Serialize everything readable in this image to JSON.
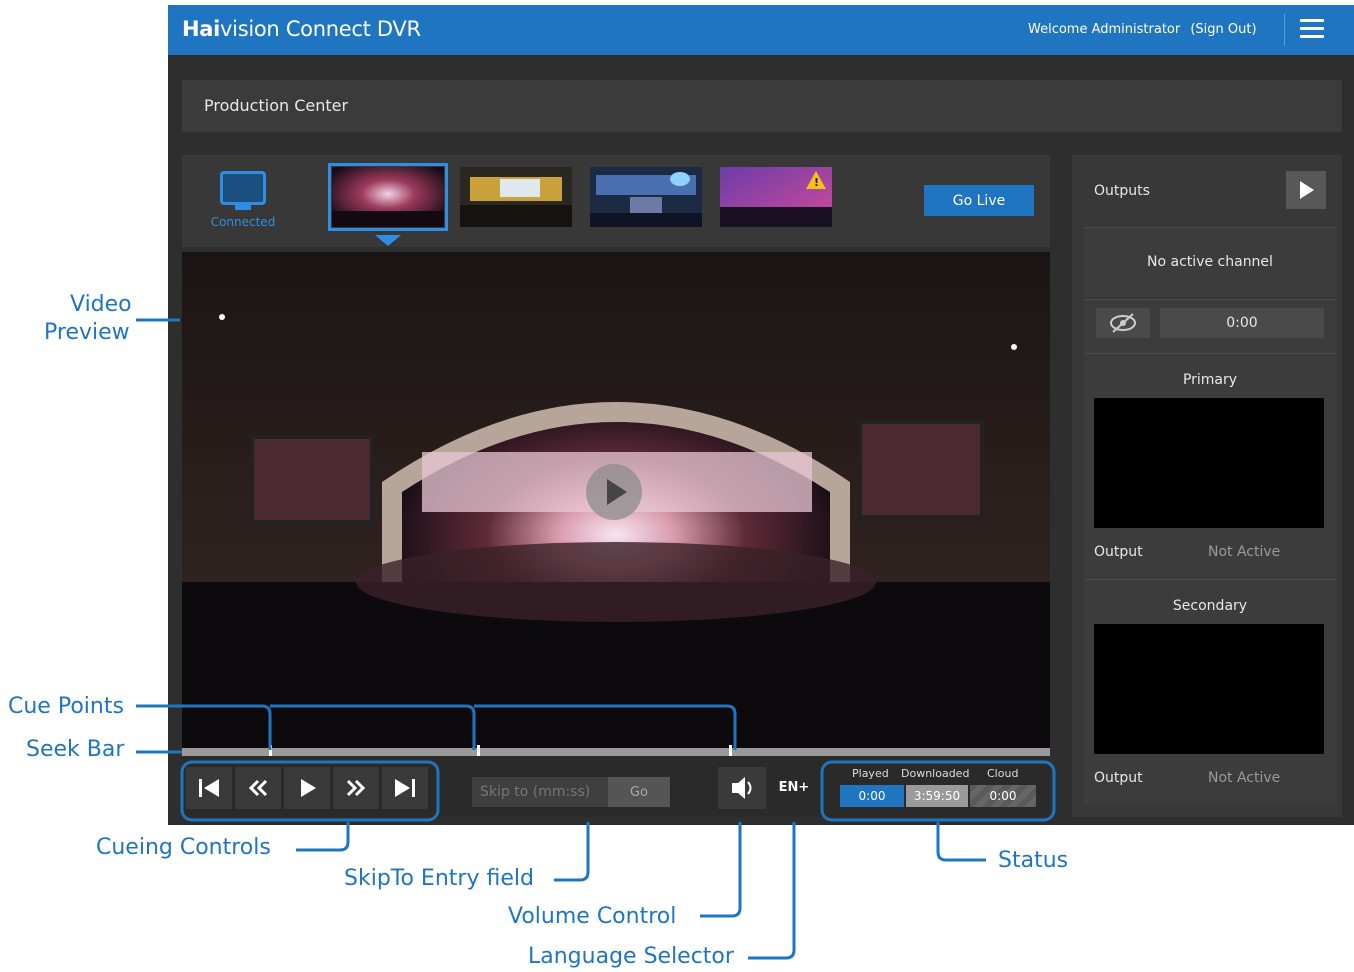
{
  "app": {
    "brand_bold": "Hai",
    "brand_rest": "vision Connect DVR",
    "welcome": "Welcome Administrator",
    "sign_out": "(Sign Out)",
    "page_title": "Production Center"
  },
  "channels": {
    "connected_label": "Connected",
    "go_live": "Go Live"
  },
  "seek": {
    "cue_points_fraction": [
      0.1,
      0.34,
      0.63
    ]
  },
  "controls": {
    "skip_placeholder": "Skip to (mm:ss)",
    "go": "Go",
    "language": "EN+",
    "status": {
      "played_header": "Played",
      "downloaded_header": "Downloaded",
      "cloud_header": "Cloud",
      "played": "0:00",
      "downloaded": "3:59:50",
      "cloud": "0:00"
    }
  },
  "outputs": {
    "header": "Outputs",
    "no_active_channel": "No active channel",
    "time": "0:00",
    "primary_title": "Primary",
    "secondary_title": "Secondary",
    "output_label": "Output",
    "not_active": "Not Active"
  },
  "annotations": {
    "video_preview_1": "Video",
    "video_preview_2": "Preview",
    "cue_points": "Cue Points",
    "seek_bar": "Seek Bar",
    "cueing_controls": "Cueing Controls",
    "skipto": "SkipTo Entry field",
    "volume": "Volume Control",
    "language": "Language Selector",
    "status": "Status"
  },
  "colors": {
    "brand_blue": "#1f75c0",
    "annotation_blue": "#1f75c0",
    "warning_yellow": "#f5c018"
  }
}
